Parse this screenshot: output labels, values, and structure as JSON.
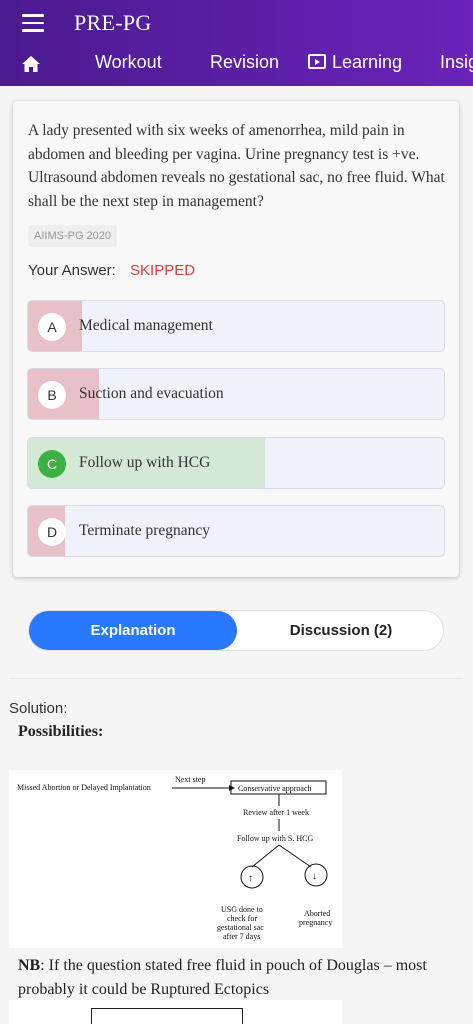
{
  "app": {
    "title": "PRE-PG"
  },
  "nav": {
    "items": [
      "Workout",
      "Revision",
      "Learning",
      "Insig"
    ]
  },
  "question": {
    "text": "A lady presented with six weeks of amenorrhea, mild pain in abdomen and bleeding per vagina. Urine pregnancy test is +ve. Ultrasound abdomen reveals no gestational sac, no free fluid. What shall be the next step in management?",
    "source": "AIIMS-PG 2020",
    "answer_label": "Your Answer:",
    "answer_value": "SKIPPED"
  },
  "options": [
    {
      "letter": "A",
      "text": "Medical management",
      "fill_fraction": 0.13,
      "status": "wrong"
    },
    {
      "letter": "B",
      "text": "Suction and evacuation",
      "fill_fraction": 0.17,
      "status": "wrong"
    },
    {
      "letter": "C",
      "text": "Follow up with HCG",
      "fill_fraction": 0.57,
      "status": "correct"
    },
    {
      "letter": "D",
      "text": "Terminate pregnancy",
      "fill_fraction": 0.09,
      "status": "wrong"
    }
  ],
  "tabs": {
    "explanation": "Explanation",
    "discussion": "Discussion (2)"
  },
  "solution": {
    "label": "Solution:",
    "subheading": "Possibilities:",
    "flow": {
      "start": "Missed Abortion or Delayed Implantation",
      "arrow_label": "Next step",
      "box": "Conservative approach",
      "step1": "Review after 1 week",
      "step2": "Follow up with S. HCG",
      "up_symbol": "↑",
      "down_symbol": "↓",
      "left_result": [
        "USG done to",
        "check for",
        "gestational sac",
        "after 7 days"
      ],
      "right_result": [
        "Aborted",
        "pregnancy"
      ]
    },
    "nb_label": "NB",
    "nb_text": ": If the question stated free fluid in pouch of Douglas – most probably it could be Ruptured Ectopics"
  },
  "colors": {
    "header": "#5a1fa5",
    "wrong_fill": "#e8c0c8",
    "correct_fill": "#d3e9d5",
    "correct_badge": "#3cb043",
    "skipped": "#e33b3b",
    "tab_active": "#2979ff"
  },
  "icons": {
    "menu": "hamburger-icon",
    "home": "home-icon",
    "learning": "play-screen-icon"
  }
}
